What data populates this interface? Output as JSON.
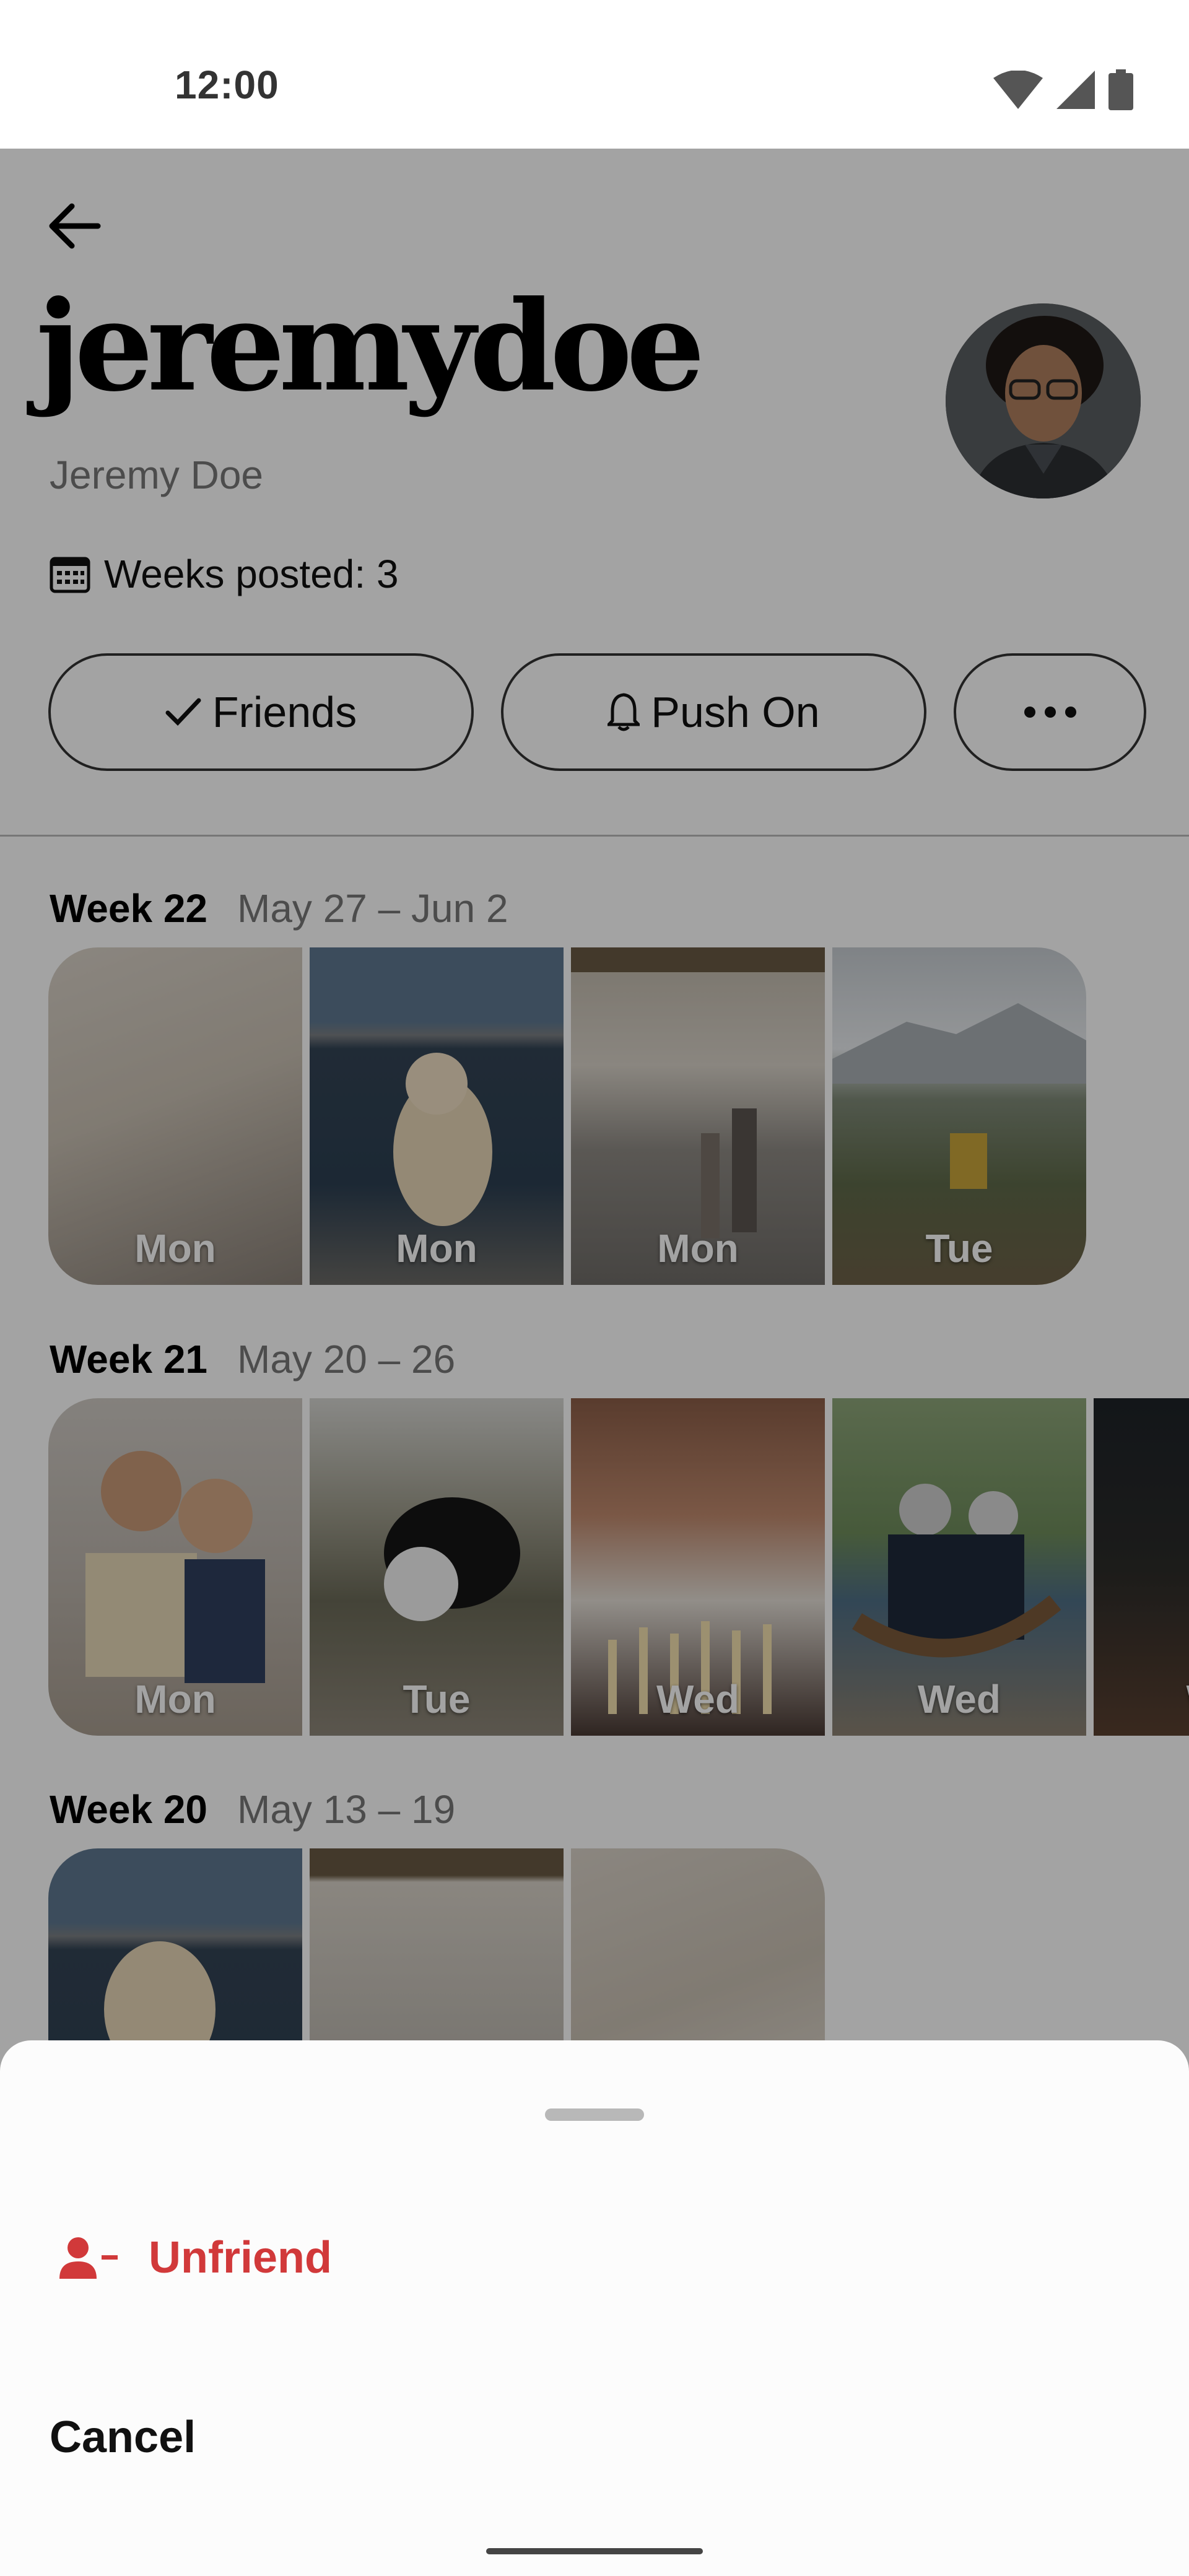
{
  "status_bar": {
    "time": "12:00"
  },
  "profile": {
    "username": "jeremydoe",
    "display_name": "Jeremy Doe",
    "weeks_posted": "Weeks posted: 3",
    "buttons": {
      "friends": "Friends",
      "push": "Push On"
    }
  },
  "weeks": [
    {
      "title": "Week 22",
      "range": "May 27 – Jun 2",
      "days": [
        "Mon",
        "Mon",
        "Mon",
        "Tue"
      ]
    },
    {
      "title": "Week 21",
      "range": "May 20 – 26",
      "days": [
        "Mon",
        "Tue",
        "Wed",
        "Wed",
        "W"
      ]
    },
    {
      "title": "Week 20",
      "range": "May 13 – 19",
      "days": [
        "",
        "",
        ""
      ]
    }
  ],
  "sheet": {
    "unfriend": "Unfriend",
    "cancel": "Cancel"
  },
  "icons": [
    "back-arrow-icon",
    "calendar-icon",
    "check-icon",
    "bell-icon",
    "more-dots-icon",
    "remove-person-icon",
    "wifi-icon",
    "signal-icon",
    "battery-icon"
  ],
  "colors": {
    "destructive": "#d1393a",
    "secondary_text": "#777777"
  }
}
